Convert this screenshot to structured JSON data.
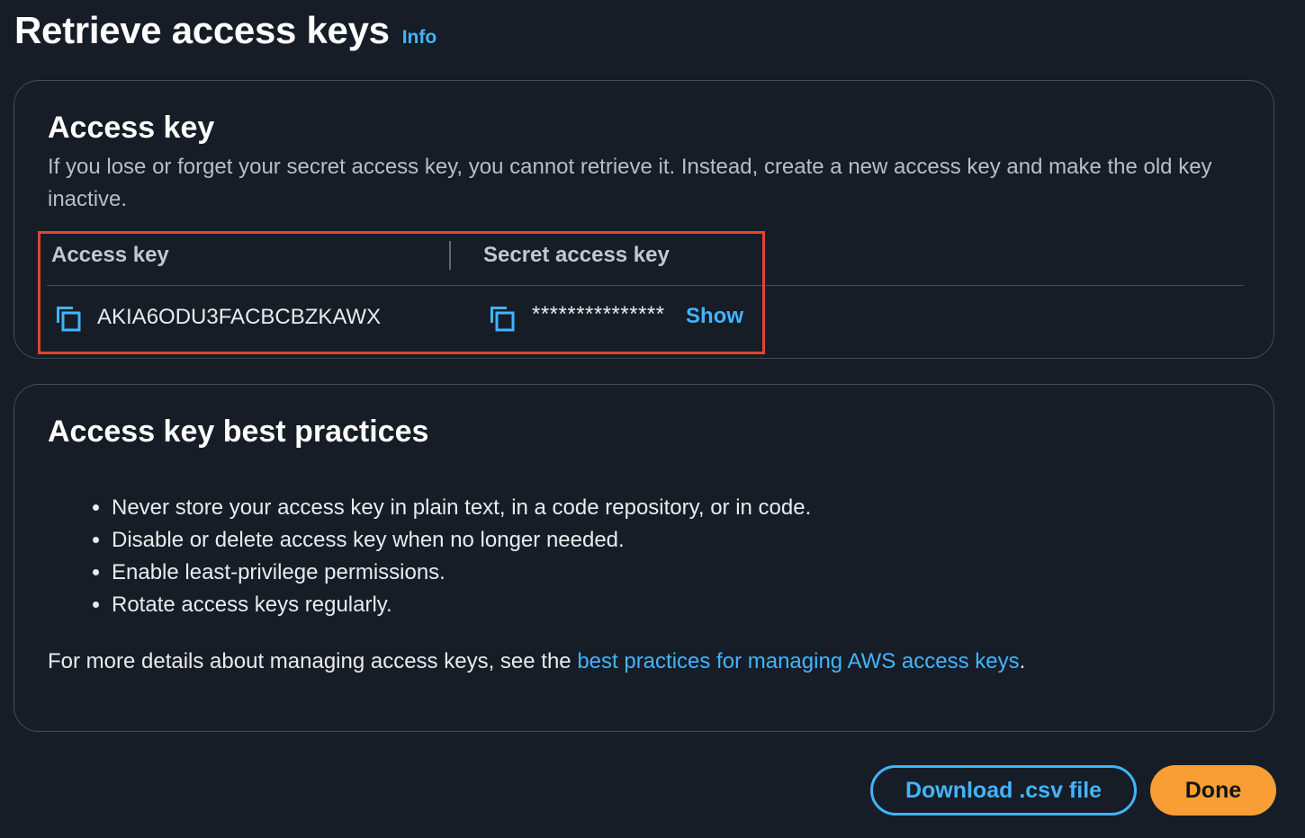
{
  "header": {
    "title": "Retrieve access keys",
    "info_link": "Info"
  },
  "access_key_panel": {
    "title": "Access key",
    "description": "If you lose or forget your secret access key, you cannot retrieve it. Instead, create a new access key and make the old key inactive.",
    "table": {
      "columns": [
        "Access key",
        "Secret access key"
      ],
      "access_key_value": "AKIA6ODU3FACBCBZKAWX",
      "secret_key_masked": "***************",
      "show_label": "Show"
    }
  },
  "best_practices_panel": {
    "title": "Access key best practices",
    "items": [
      "Never store your access key in plain text, in a code repository, or in code.",
      "Disable or delete access key when no longer needed.",
      "Enable least-privilege permissions.",
      "Rotate access keys regularly."
    ],
    "more_details_prefix": "For more details about managing access keys, see the ",
    "more_details_link": "best practices for managing AWS access keys",
    "more_details_suffix": "."
  },
  "actions": {
    "download_label": "Download .csv file",
    "done_label": "Done"
  },
  "colors": {
    "background": "#161d26",
    "link": "#42b4ff",
    "primary_button": "#f89e35",
    "highlight": "#e0452f"
  }
}
